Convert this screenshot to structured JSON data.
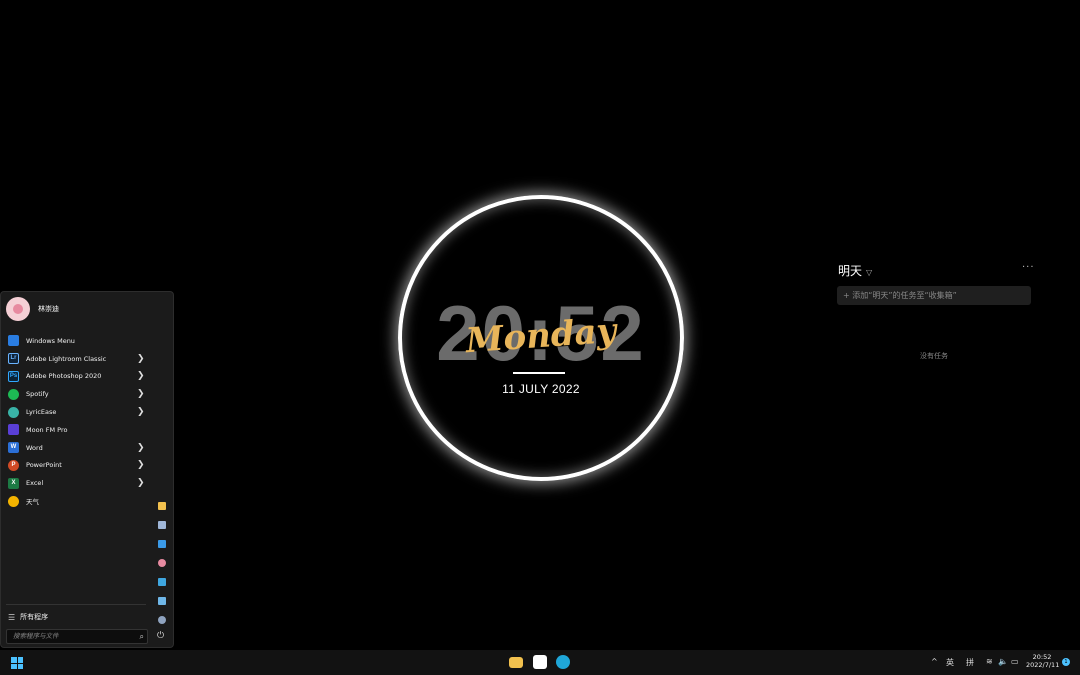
{
  "clock": {
    "time": "20:52",
    "day": "Monday",
    "date": "11 JULY 2022"
  },
  "tasks": {
    "title": "明天",
    "more": "···",
    "placeholder": "+ 添加“明天”的任务至“收集箱”",
    "empty_text": "没有任务"
  },
  "start_menu": {
    "user_name": "林崇迪",
    "apps": [
      {
        "label": "Windows Menu",
        "icon": "windows-menu-icon",
        "color": "#2a7de1",
        "glyph": "",
        "chevron": false
      },
      {
        "label": "Adobe Lightroom Classic",
        "icon": "lightroom-icon",
        "color": "#0f2236",
        "glyph": "Lr",
        "chevron": true
      },
      {
        "label": "Adobe Photoshop 2020",
        "icon": "photoshop-icon",
        "color": "#0a2236",
        "glyph": "Ps",
        "chevron": true
      },
      {
        "label": "Spotify",
        "icon": "spotify-icon",
        "color": "#1db954",
        "glyph": "",
        "chevron": true
      },
      {
        "label": "LyricEase",
        "icon": "lyricease-icon",
        "color": "#39b3a7",
        "glyph": "",
        "chevron": true
      },
      {
        "label": "Moon FM Pro",
        "icon": "moonfm-icon",
        "color": "#5a3fd6",
        "glyph": "",
        "chevron": false
      },
      {
        "label": "Word",
        "icon": "word-icon",
        "color": "#2b6fd6",
        "glyph": "W",
        "chevron": true
      },
      {
        "label": "PowerPoint",
        "icon": "powerpoint-icon",
        "color": "#d04a25",
        "glyph": "P",
        "chevron": true
      },
      {
        "label": "Excel",
        "icon": "excel-icon",
        "color": "#1d7a44",
        "glyph": "X",
        "chevron": true
      },
      {
        "label": "天气",
        "icon": "weather-icon",
        "color": "#f4b400",
        "glyph": "",
        "chevron": false
      }
    ],
    "all_apps_label": "所有程序",
    "search_placeholder": "搜索程序与文件"
  },
  "taskbar": {
    "tray_chevron": "^",
    "lang_1": "英",
    "lang_2": "拼",
    "time": "20:52",
    "date": "2022/7/11",
    "notification_count": "1"
  },
  "colors": {
    "accent": "#4cc2ff",
    "clock_day": "#e8b55a"
  }
}
